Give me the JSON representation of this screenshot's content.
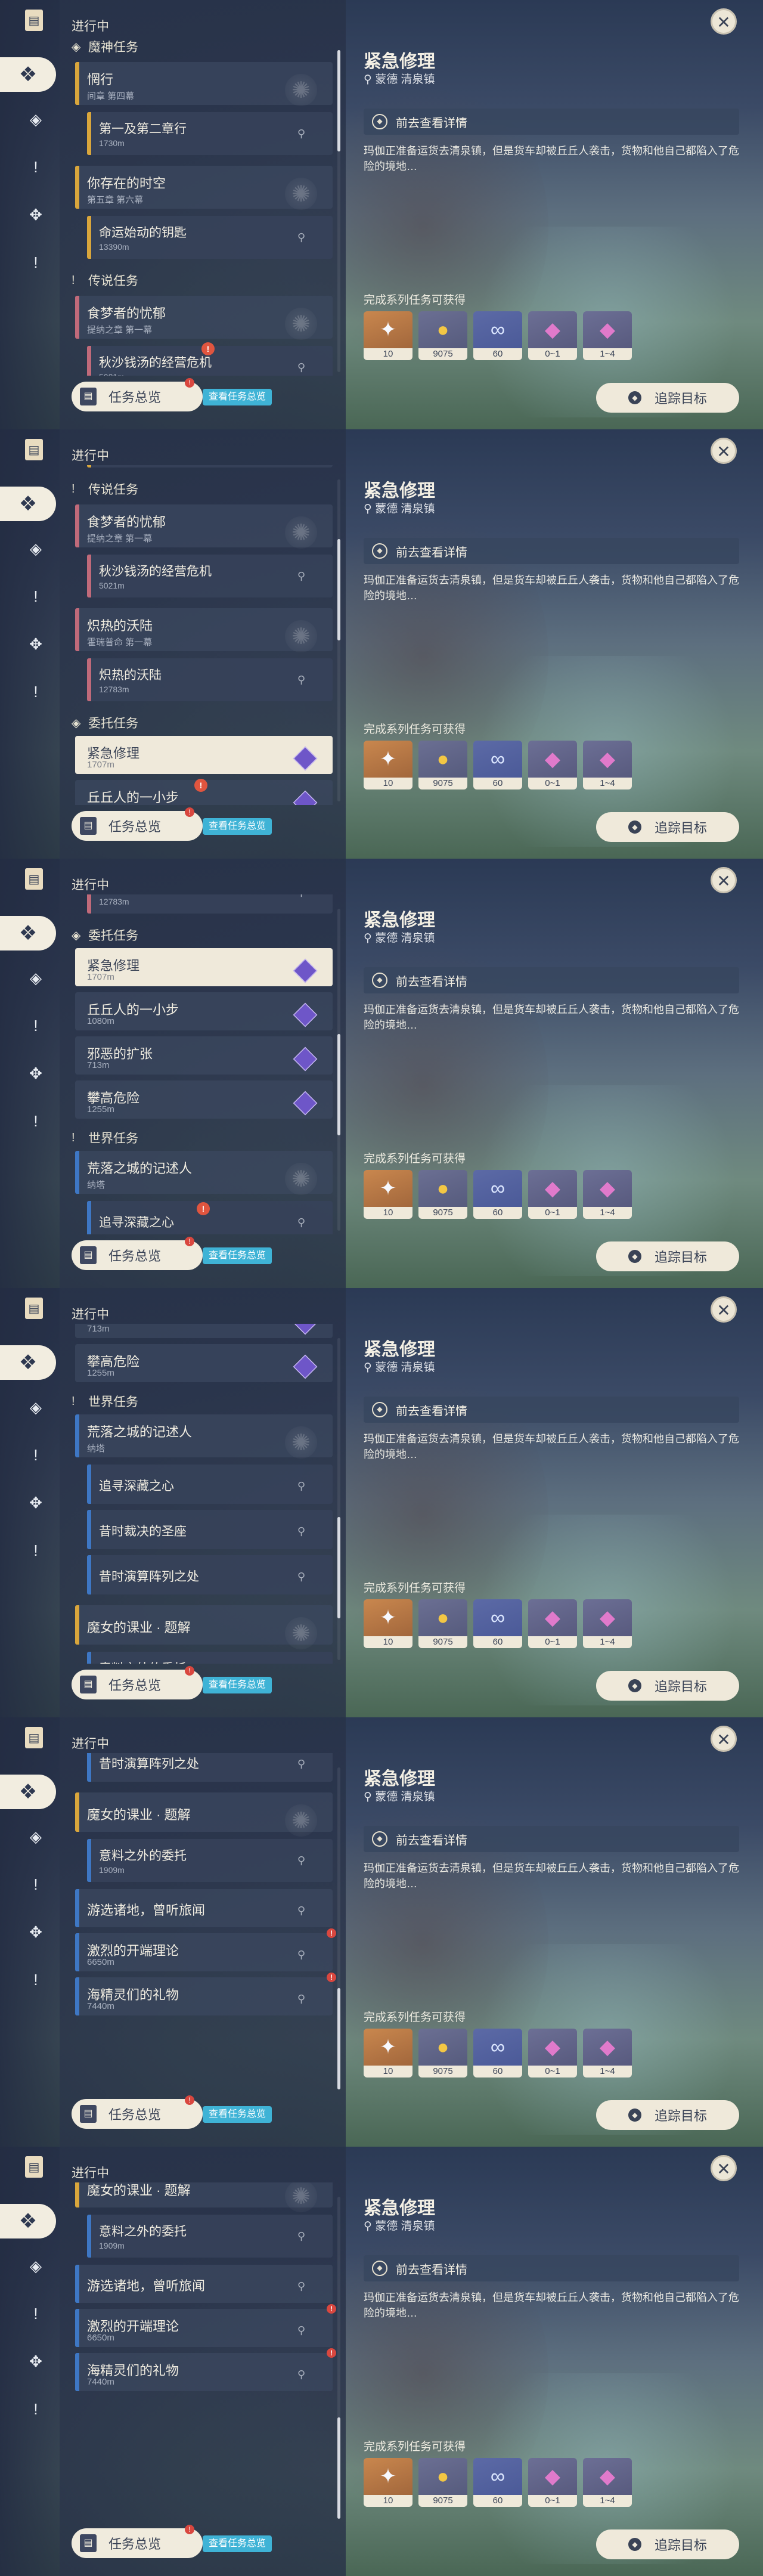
{
  "status_label": "进行中",
  "sidebar_icons": [
    "quest-book-icon",
    "all-quests-icon",
    "archon-quest-icon",
    "story-quest-icon",
    "world-quest-icon",
    "commission-icon"
  ],
  "list": {
    "sections": {
      "archon": "魔神任务",
      "legend": "传说任务",
      "commission": "委托任务",
      "world": "世界任务"
    },
    "quests": {
      "wangxian": {
        "title": "惘行",
        "sub": "间章 第四幕"
      },
      "wangxian_step": {
        "title": "第一及第二章行",
        "sub": "1730m"
      },
      "cunzai": {
        "title": "你存在的时空",
        "sub": "第五章 第六幕"
      },
      "cunzai_step": {
        "title": "命运始动的钥匙",
        "sub": "13390m"
      },
      "shimeng": {
        "title": "食梦者的忧郁",
        "sub": "提纳之章 第一幕"
      },
      "shimeng_step": {
        "title": "秋沙钱汤的经营危机",
        "sub": "5021m"
      },
      "zhire": {
        "title": "炽热的沃陆",
        "sub": "霍瑞普命 第一幕"
      },
      "zhire_step": {
        "title": "炽热的沃陆",
        "sub": "12783m"
      },
      "jinji": {
        "title": "紧急修理",
        "sub": "1707m"
      },
      "qiuqiu": {
        "title": "丘丘人的一小步",
        "sub": "1080m"
      },
      "xiee": {
        "title": "邪恶的扩张",
        "sub": "713m"
      },
      "pangao": {
        "title": "攀高危险",
        "sub": "1255m"
      },
      "huangwu": {
        "title": "荒落之城的记述人",
        "sub": "纳塔"
      },
      "zhuixun": {
        "title": "追寻深藏之心"
      },
      "xishi": {
        "title": "昔时裁决的圣座"
      },
      "yansuan": {
        "title": "昔时演算阵列之处"
      },
      "monv": {
        "title": "魔女的课业 · 题解"
      },
      "yiliao": {
        "title": "意料之外的委托",
        "sub": "1909m"
      },
      "youxuan": {
        "title": "游选诸地，曾听旅闻"
      },
      "jidang": {
        "title": "激烈的开端理论",
        "sub": "6650m"
      },
      "haijing": {
        "title": "海精灵们的礼物",
        "sub": "7440m"
      }
    }
  },
  "footer": {
    "overview_label": "任务总览",
    "overview_tag": "查看任务总览",
    "overview_badge": "!",
    "track_label": "追踪目标"
  },
  "detail": {
    "title": "紧急修理",
    "location": "蒙德 清泉镇",
    "goto_label": "前去查看详情",
    "description": "玛伽正准备运货去清泉镇，但是货车却被丘丘人袭击，货物和他自己都陷入了危险的境地…",
    "reward_title": "完成系列任务可获得",
    "rewards": [
      {
        "icon": "adventure-exp-icon",
        "count": "10"
      },
      {
        "icon": "mora-icon",
        "count": "9075"
      },
      {
        "icon": "fate-icon",
        "count": "60"
      },
      {
        "icon": "crystal-small-icon",
        "count": "0~1"
      },
      {
        "icon": "crystal-large-icon",
        "count": "1~4"
      }
    ]
  },
  "close_icon": "close-icon",
  "accent_colors": {
    "archon": "#d9a63c",
    "legend": "#c06a7a",
    "world": "#3e77c4",
    "commission": "#b8b0a0",
    "warn": "#e0553f",
    "tag": "#3fb3d6"
  }
}
